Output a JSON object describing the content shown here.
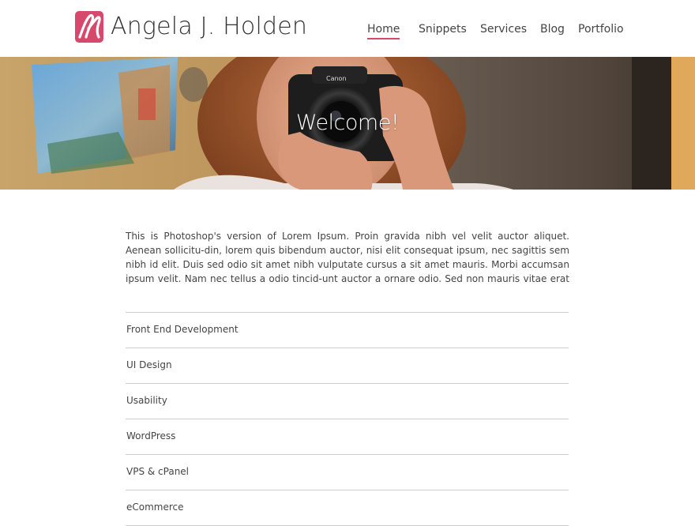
{
  "brand": {
    "name": "Angela J. Holden",
    "logo_icon": "ah-monogram-icon",
    "accent_color": "#d6496c"
  },
  "nav": {
    "items": [
      {
        "label": "Home",
        "active": true
      },
      {
        "label": "Snippets",
        "active": false
      },
      {
        "label": "Services",
        "active": false
      },
      {
        "label": "Blog",
        "active": false
      },
      {
        "label": "Portfolio",
        "active": false
      }
    ]
  },
  "hero": {
    "title": "Welcome!",
    "camera_brand": "Canon"
  },
  "intro": {
    "text": "This is Photoshop's version  of Lorem Ipsum. Proin gravida nibh vel velit auctor aliquet. Aenean sollicitu-din, lorem quis bibendum auctor, nisi elit consequat ipsum, nec sagittis sem nibh id elit. Duis sed odio sit amet nibh vulputate cursus a sit amet mauris. Morbi accumsan ipsum velit. Nam nec tellus a odio tincid-unt auctor a ornare odio. Sed non  mauris vitae erat consequat auctor eu in elit. Class aptent taciti so-"
  },
  "services": {
    "items": [
      {
        "label": "Front End Development"
      },
      {
        "label": "UI Design"
      },
      {
        "label": "Usability"
      },
      {
        "label": "WordPress"
      },
      {
        "label": "VPS & cPanel"
      },
      {
        "label": "eCommerce"
      }
    ]
  }
}
